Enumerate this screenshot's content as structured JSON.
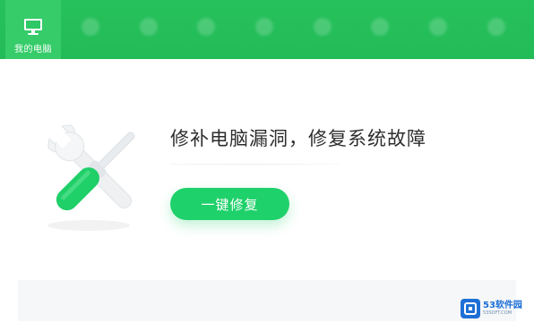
{
  "tabs": [
    {
      "label": "我的电脑",
      "icon": "monitor-icon",
      "active": true
    },
    {
      "label": "",
      "icon": "blurred-icon",
      "active": false
    },
    {
      "label": "",
      "icon": "blurred-icon",
      "active": false
    },
    {
      "label": "",
      "icon": "blurred-icon",
      "active": false
    },
    {
      "label": "",
      "icon": "blurred-icon",
      "active": false
    },
    {
      "label": "",
      "icon": "blurred-icon",
      "active": false
    },
    {
      "label": "",
      "icon": "blurred-icon",
      "active": false
    },
    {
      "label": "",
      "icon": "blurred-icon",
      "active": false
    },
    {
      "label": "",
      "icon": "blurred-icon",
      "active": false
    }
  ],
  "main": {
    "headline": "修补电脑漏洞，修复系统故障",
    "fix_button": "一键修复"
  },
  "watermark": {
    "brand": "53软件园",
    "site": "53SOFT.COM"
  },
  "colors": {
    "topbar": "#22bb57",
    "button": "#1fd16a",
    "watermark": "#1d6fd6"
  }
}
